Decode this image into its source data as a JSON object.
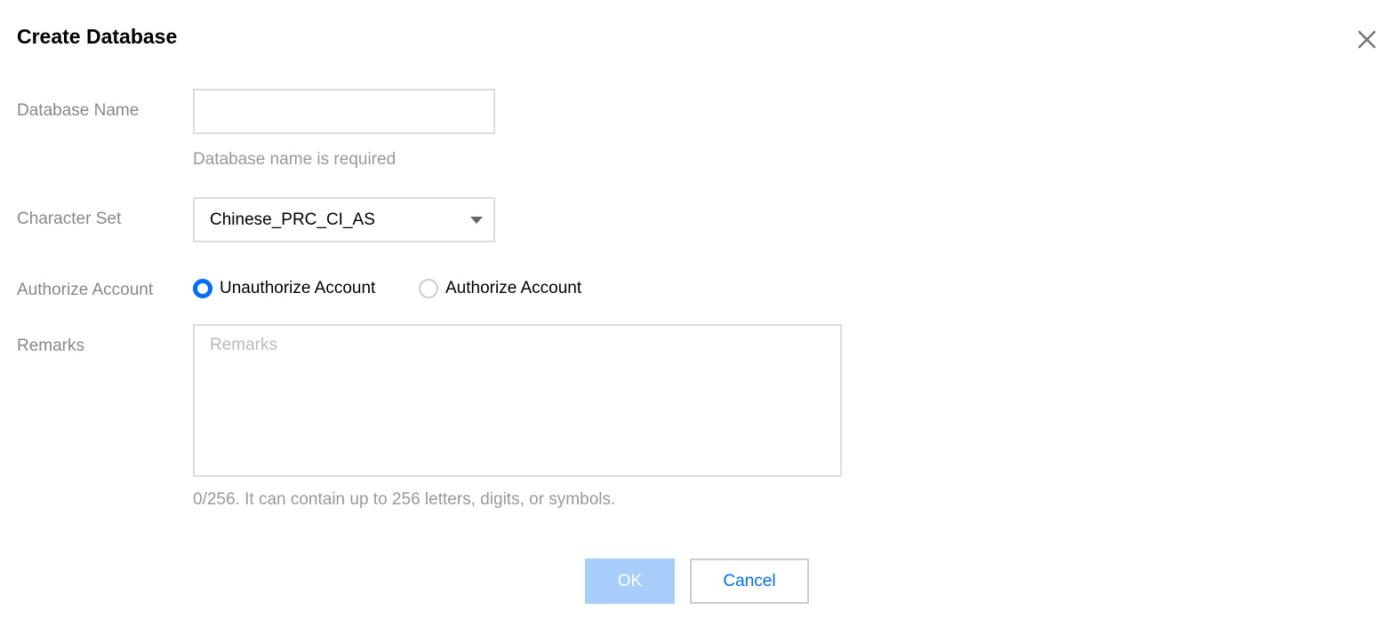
{
  "dialog": {
    "title": "Create Database",
    "close_icon": "close-icon"
  },
  "form": {
    "database_name": {
      "label": "Database Name",
      "value": "",
      "hint": "Database name is required"
    },
    "character_set": {
      "label": "Character Set",
      "selected": "Chinese_PRC_CI_AS",
      "caret_icon": "caret-down-icon"
    },
    "authorize_account": {
      "label": "Authorize Account",
      "options": [
        {
          "label": "Unauthorize Account",
          "checked": true
        },
        {
          "label": "Authorize Account",
          "checked": false
        }
      ]
    },
    "remarks": {
      "label": "Remarks",
      "placeholder": "Remarks",
      "value": "",
      "counter_hint": "0/256. It can contain up to 256 letters, digits, or symbols."
    }
  },
  "footer": {
    "ok_label": "OK",
    "cancel_label": "Cancel"
  },
  "colors": {
    "accent": "#006eff",
    "ok_disabled_bg": "#a7cdfb",
    "label_gray": "#888888",
    "border": "#dddddd"
  }
}
